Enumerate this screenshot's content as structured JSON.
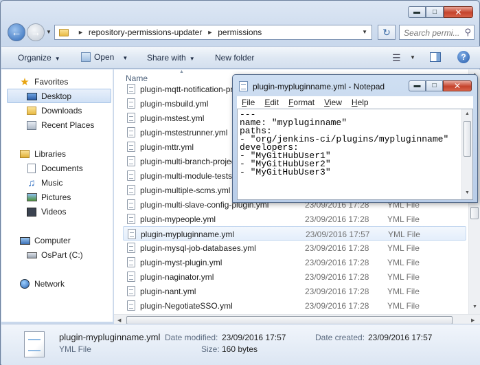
{
  "explorer": {
    "breadcrumb": [
      "repository-permissions-updater",
      "permissions"
    ],
    "search_placeholder": "Search permi...",
    "toolbar": {
      "organize": "Organize",
      "open": "Open",
      "share_with": "Share with",
      "new_folder": "New folder"
    },
    "nav": {
      "favorites": "Favorites",
      "desktop": "Desktop",
      "downloads": "Downloads",
      "recent_places": "Recent Places",
      "libraries": "Libraries",
      "documents": "Documents",
      "music": "Music",
      "pictures": "Pictures",
      "videos": "Videos",
      "computer": "Computer",
      "ospart": "OsPart (C:)",
      "network": "Network"
    },
    "column_name": "Name",
    "files": [
      {
        "name": "plugin-mqtt-notification-property.yml",
        "date": "",
        "type": ""
      },
      {
        "name": "plugin-msbuild.yml",
        "date": "",
        "type": ""
      },
      {
        "name": "plugin-mstest.yml",
        "date": "",
        "type": ""
      },
      {
        "name": "plugin-mstestrunner.yml",
        "date": "",
        "type": ""
      },
      {
        "name": "plugin-mttr.yml",
        "date": "",
        "type": ""
      },
      {
        "name": "plugin-multi-branch-project-plugin.yml",
        "date": "",
        "type": ""
      },
      {
        "name": "plugin-multi-module-tests-publisher.yml",
        "date": "",
        "type": ""
      },
      {
        "name": "plugin-multiple-scms.yml",
        "date": "",
        "type": ""
      },
      {
        "name": "plugin-multi-slave-config-plugin.yml",
        "date": "23/09/2016 17:28",
        "type": "YML File"
      },
      {
        "name": "plugin-mypeople.yml",
        "date": "23/09/2016 17:28",
        "type": "YML File"
      },
      {
        "name": "plugin-mypluginname.yml",
        "date": "23/09/2016 17:57",
        "type": "YML File"
      },
      {
        "name": "plugin-mysql-job-databases.yml",
        "date": "23/09/2016 17:28",
        "type": "YML File"
      },
      {
        "name": "plugin-myst-plugin.yml",
        "date": "23/09/2016 17:28",
        "type": "YML File"
      },
      {
        "name": "plugin-naginator.yml",
        "date": "23/09/2016 17:28",
        "type": "YML File"
      },
      {
        "name": "plugin-nant.yml",
        "date": "23/09/2016 17:28",
        "type": "YML File"
      },
      {
        "name": "plugin-NegotiateSSO.yml",
        "date": "23/09/2016 17:28",
        "type": "YML File"
      }
    ],
    "details": {
      "filename": "plugin-mypluginname.yml",
      "filetype": "YML File",
      "date_modified_label": "Date modified:",
      "date_modified": "23/09/2016 17:57",
      "size_label": "Size:",
      "size": "160 bytes",
      "date_created_label": "Date created:",
      "date_created": "23/09/2016 17:57"
    }
  },
  "notepad": {
    "title": "plugin-mypluginname.yml - Notepad",
    "menu": [
      "File",
      "Edit",
      "Format",
      "View",
      "Help"
    ],
    "content": "---\nname: \"mypluginname\"\npaths:\n- \"org/jenkins-ci/plugins/mypluginname\"\ndevelopers:\n- \"MyGitHubUser1\"\n- \"MyGitHubUser2\"\n- \"MyGitHubUser3\""
  },
  "icons": {
    "back": "back-arrow-icon",
    "forward": "forward-arrow-icon",
    "refresh": "refresh-icon",
    "search": "search-icon",
    "favorites": "star-icon",
    "folder": "folder-icon",
    "file": "yml-file-icon"
  },
  "colors": {
    "selection": "#e4eefb",
    "close_button": "#c5432c",
    "chrome": "#c9d8ec"
  }
}
